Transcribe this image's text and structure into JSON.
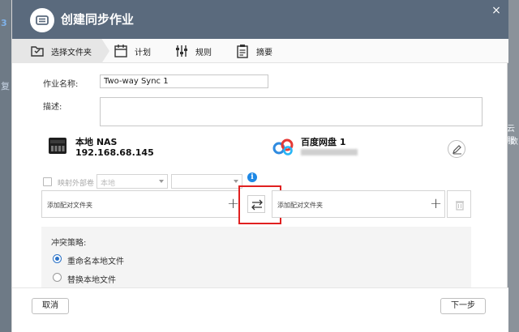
{
  "background": {
    "left_glyphs": [
      "3",
      "复"
    ],
    "right_glyphs": [
      "云服",
      "数"
    ]
  },
  "dialog": {
    "title": "创建同步作业",
    "close_glyph": "×"
  },
  "steps": [
    {
      "label": "选择文件夹",
      "icon": "folder-select-icon",
      "active": true
    },
    {
      "label": "计划",
      "icon": "calendar-icon",
      "active": false
    },
    {
      "label": "规则",
      "icon": "sliders-icon",
      "active": false
    },
    {
      "label": "摘要",
      "icon": "clipboard-icon",
      "active": false
    }
  ],
  "form": {
    "job_name_label": "作业名称:",
    "job_name_value": "Two-way Sync 1",
    "description_label": "描述:",
    "description_value": ""
  },
  "local": {
    "name": "本地 NAS",
    "ip": "192.168.68.145",
    "icon": "nas-device-icon"
  },
  "remote": {
    "name": "百度网盘 1",
    "icon": "baidu-cloud-icon",
    "edit_icon": "edit-icon"
  },
  "mapping": {
    "checkbox_label": "映射外部卷",
    "select1_value": "本地",
    "select2_value": "",
    "info_glyph": "i"
  },
  "pair": {
    "local_placeholder": "添加配对文件夹",
    "remote_placeholder": "添加配对文件夹",
    "plus_glyph": "+",
    "swap_icon": "swap-arrows-icon",
    "trash_icon": "trash-icon"
  },
  "policy": {
    "title": "冲突策略:",
    "options": [
      {
        "label": "重命名本地文件",
        "selected": true
      },
      {
        "label": "替换本地文件",
        "selected": false
      }
    ]
  },
  "footer": {
    "cancel_label": "取消",
    "next_label": "下一步"
  },
  "colors": {
    "titlebar": "#5a6a7d",
    "highlight": "#e02020",
    "radio_active": "#2a72c7",
    "info": "#1e88e5"
  }
}
